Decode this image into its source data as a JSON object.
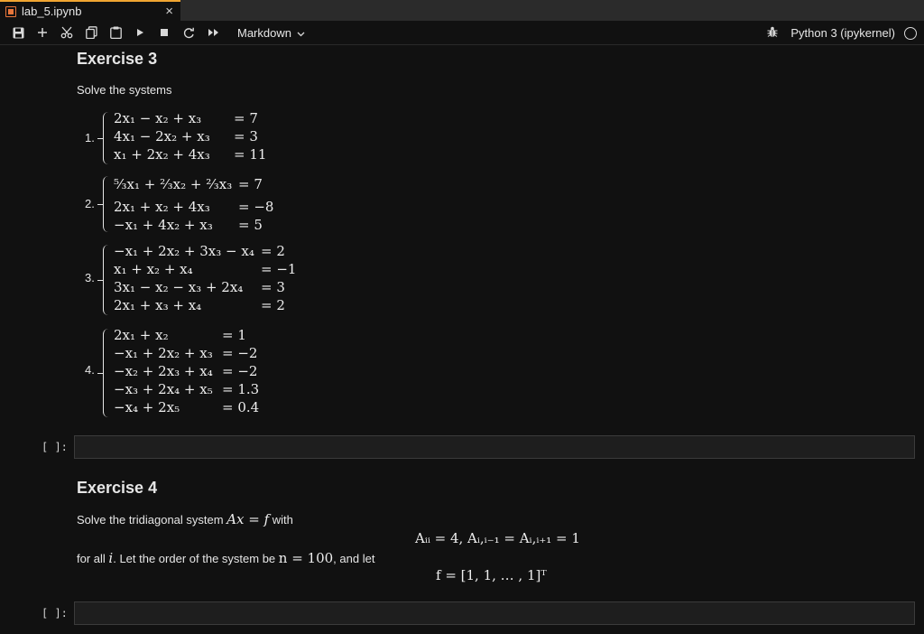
{
  "tab": {
    "title": "lab_5.ipynb",
    "close": "×"
  },
  "toolbar": {
    "cell_type": "Markdown",
    "kernel_name": "Python 3 (ipykernel)",
    "icons": [
      "save-icon",
      "add-icon",
      "cut-icon",
      "copy-icon",
      "paste-icon",
      "run-icon",
      "stop-icon",
      "restart-icon",
      "fast-forward-icon"
    ]
  },
  "exercise3": {
    "title": "Exercise 3",
    "intro": "Solve the systems",
    "systems": [
      {
        "num": "1.",
        "rows": [
          {
            "lhs": "2x₁ − x₂ + x₃",
            "rhs": "= 7"
          },
          {
            "lhs": "4x₁ − 2x₂ + x₃",
            "rhs": "= 3"
          },
          {
            "lhs": "x₁ + 2x₂ + 4x₃",
            "rhs": "= 11"
          }
        ]
      },
      {
        "num": "2.",
        "rows": [
          {
            "lhs": "⁵⁄₃x₁ + ²⁄₃x₂ + ²⁄₃x₃",
            "rhs": "= 7"
          },
          {
            "lhs": "2x₁ + x₂ + 4x₃",
            "rhs": "= −8"
          },
          {
            "lhs": "−x₁ + 4x₂ + x₃",
            "rhs": "= 5"
          }
        ]
      },
      {
        "num": "3.",
        "rows": [
          {
            "lhs": "−x₁ + 2x₂ + 3x₃ − x₄",
            "rhs": "= 2"
          },
          {
            "lhs": "x₁ + x₂ + x₄",
            "rhs": "= −1"
          },
          {
            "lhs": "3x₁ − x₂ − x₃ + 2x₄",
            "rhs": "= 3"
          },
          {
            "lhs": "2x₁ + x₃ + x₄",
            "rhs": "= 2"
          }
        ]
      },
      {
        "num": "4.",
        "rows": [
          {
            "lhs": "2x₁ + x₂",
            "rhs": "= 1"
          },
          {
            "lhs": "−x₁ + 2x₂ + x₃",
            "rhs": "= −2"
          },
          {
            "lhs": "−x₂ + 2x₃ + x₄",
            "rhs": "= −2"
          },
          {
            "lhs": "−x₃ + 2x₄ + x₅",
            "rhs": "= 1.3"
          },
          {
            "lhs": "−x₄ + 2x₅",
            "rhs": "= 0.4"
          }
        ]
      }
    ]
  },
  "code_cell_prompt": "[ ]:",
  "exercise4": {
    "title": "Exercise 4",
    "line1_prefix": "Solve the tridiagonal system ",
    "line1_math": "Ax = f",
    "line1_suffix": " with",
    "display1": "Aᵢᵢ = 4,   Aᵢ,ᵢ₋₁ = Aᵢ,ᵢ₊₁ = 1",
    "line2_prefix": "for all ",
    "line2_i": "i",
    "line2_mid": ". Let the order of the system be ",
    "line2_math": "n = 100",
    "line2_suffix": ", and let",
    "display2": "f = [1, 1, … , 1]ᵀ"
  }
}
